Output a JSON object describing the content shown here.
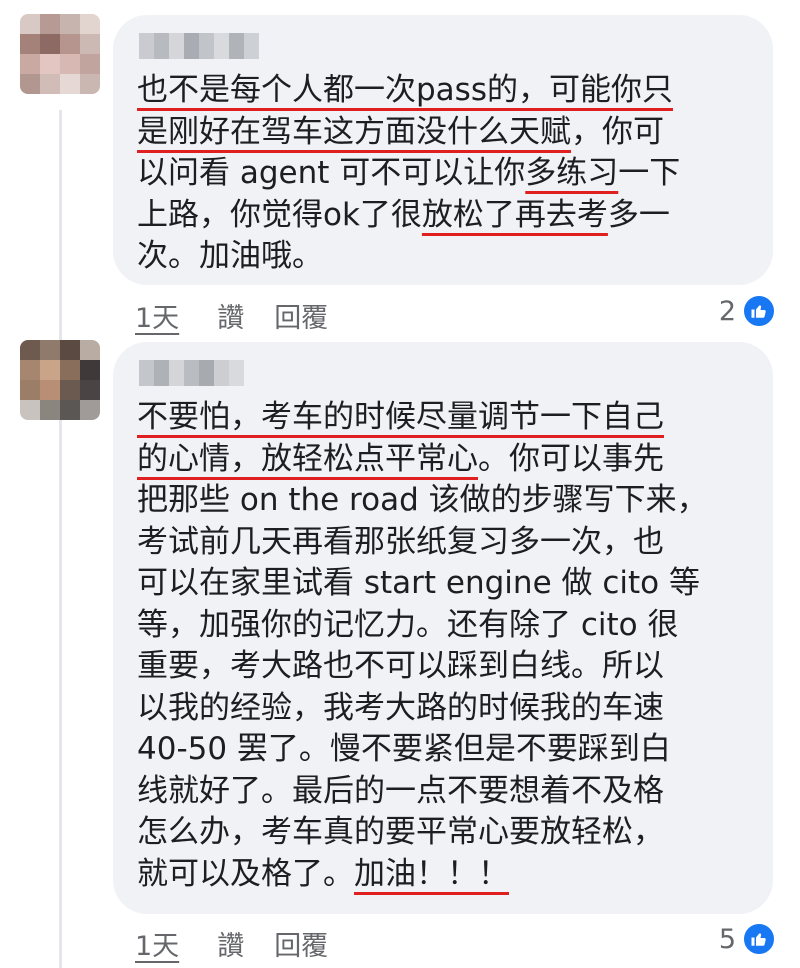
{
  "comments": [
    {
      "text_segments": [
        {
          "t": "也不是每个人都一次pass的",
          "u": true
        },
        {
          "t": "，",
          "u": true
        },
        {
          "t": "可能你只\n",
          "u": true
        },
        {
          "t": "是刚好在驾车这方面没什么天赋",
          "u": true
        },
        {
          "t": "，你可\n以问看 agent 可不可以让你",
          "u": false
        },
        {
          "t": "多练习",
          "u": true
        },
        {
          "t": "一下\n上路，你觉得ok了很",
          "u": false
        },
        {
          "t": "放松了再去考",
          "u": true
        },
        {
          "t": "多一\n次。加油哦。",
          "u": false
        }
      ],
      "age": "1天",
      "like_label": "讚",
      "reply_label": "回覆",
      "reaction_count": "2"
    },
    {
      "text_segments": [
        {
          "t": "不要怕，考车的时候尽量调节一下自己\n",
          "u": true
        },
        {
          "t": "的心情，放轻松点平常心",
          "u": true
        },
        {
          "t": "。你可以事先\n把那些 on the road 该做的步骤写下来，\n考试前几天再看那张纸复习多一次，也\n可以在家里试看 start engine 做 cito 等\n等，加强你的记忆力。还有除了 cito 很\n重要，考大路也不可以踩到白线。所以\n以我的经验，我考大路的时候我的车速\n40-50 罢了。慢不要紧但是不要踩到白\n线就好了。最后的一点不要想着不及格\n怎么办，考车真的要平常心要放轻松，\n就可以及格了。",
          "u": false
        },
        {
          "t": "加油！！！",
          "u": true
        }
      ],
      "age": "1天",
      "like_label": "讚",
      "reply_label": "回覆",
      "reaction_count": "5"
    }
  ],
  "colors": {
    "bubble": "#f0f2f5",
    "text": "#1c1e21",
    "meta": "#65676b",
    "underline": "#e02020",
    "like_blue": "#1877f2"
  }
}
